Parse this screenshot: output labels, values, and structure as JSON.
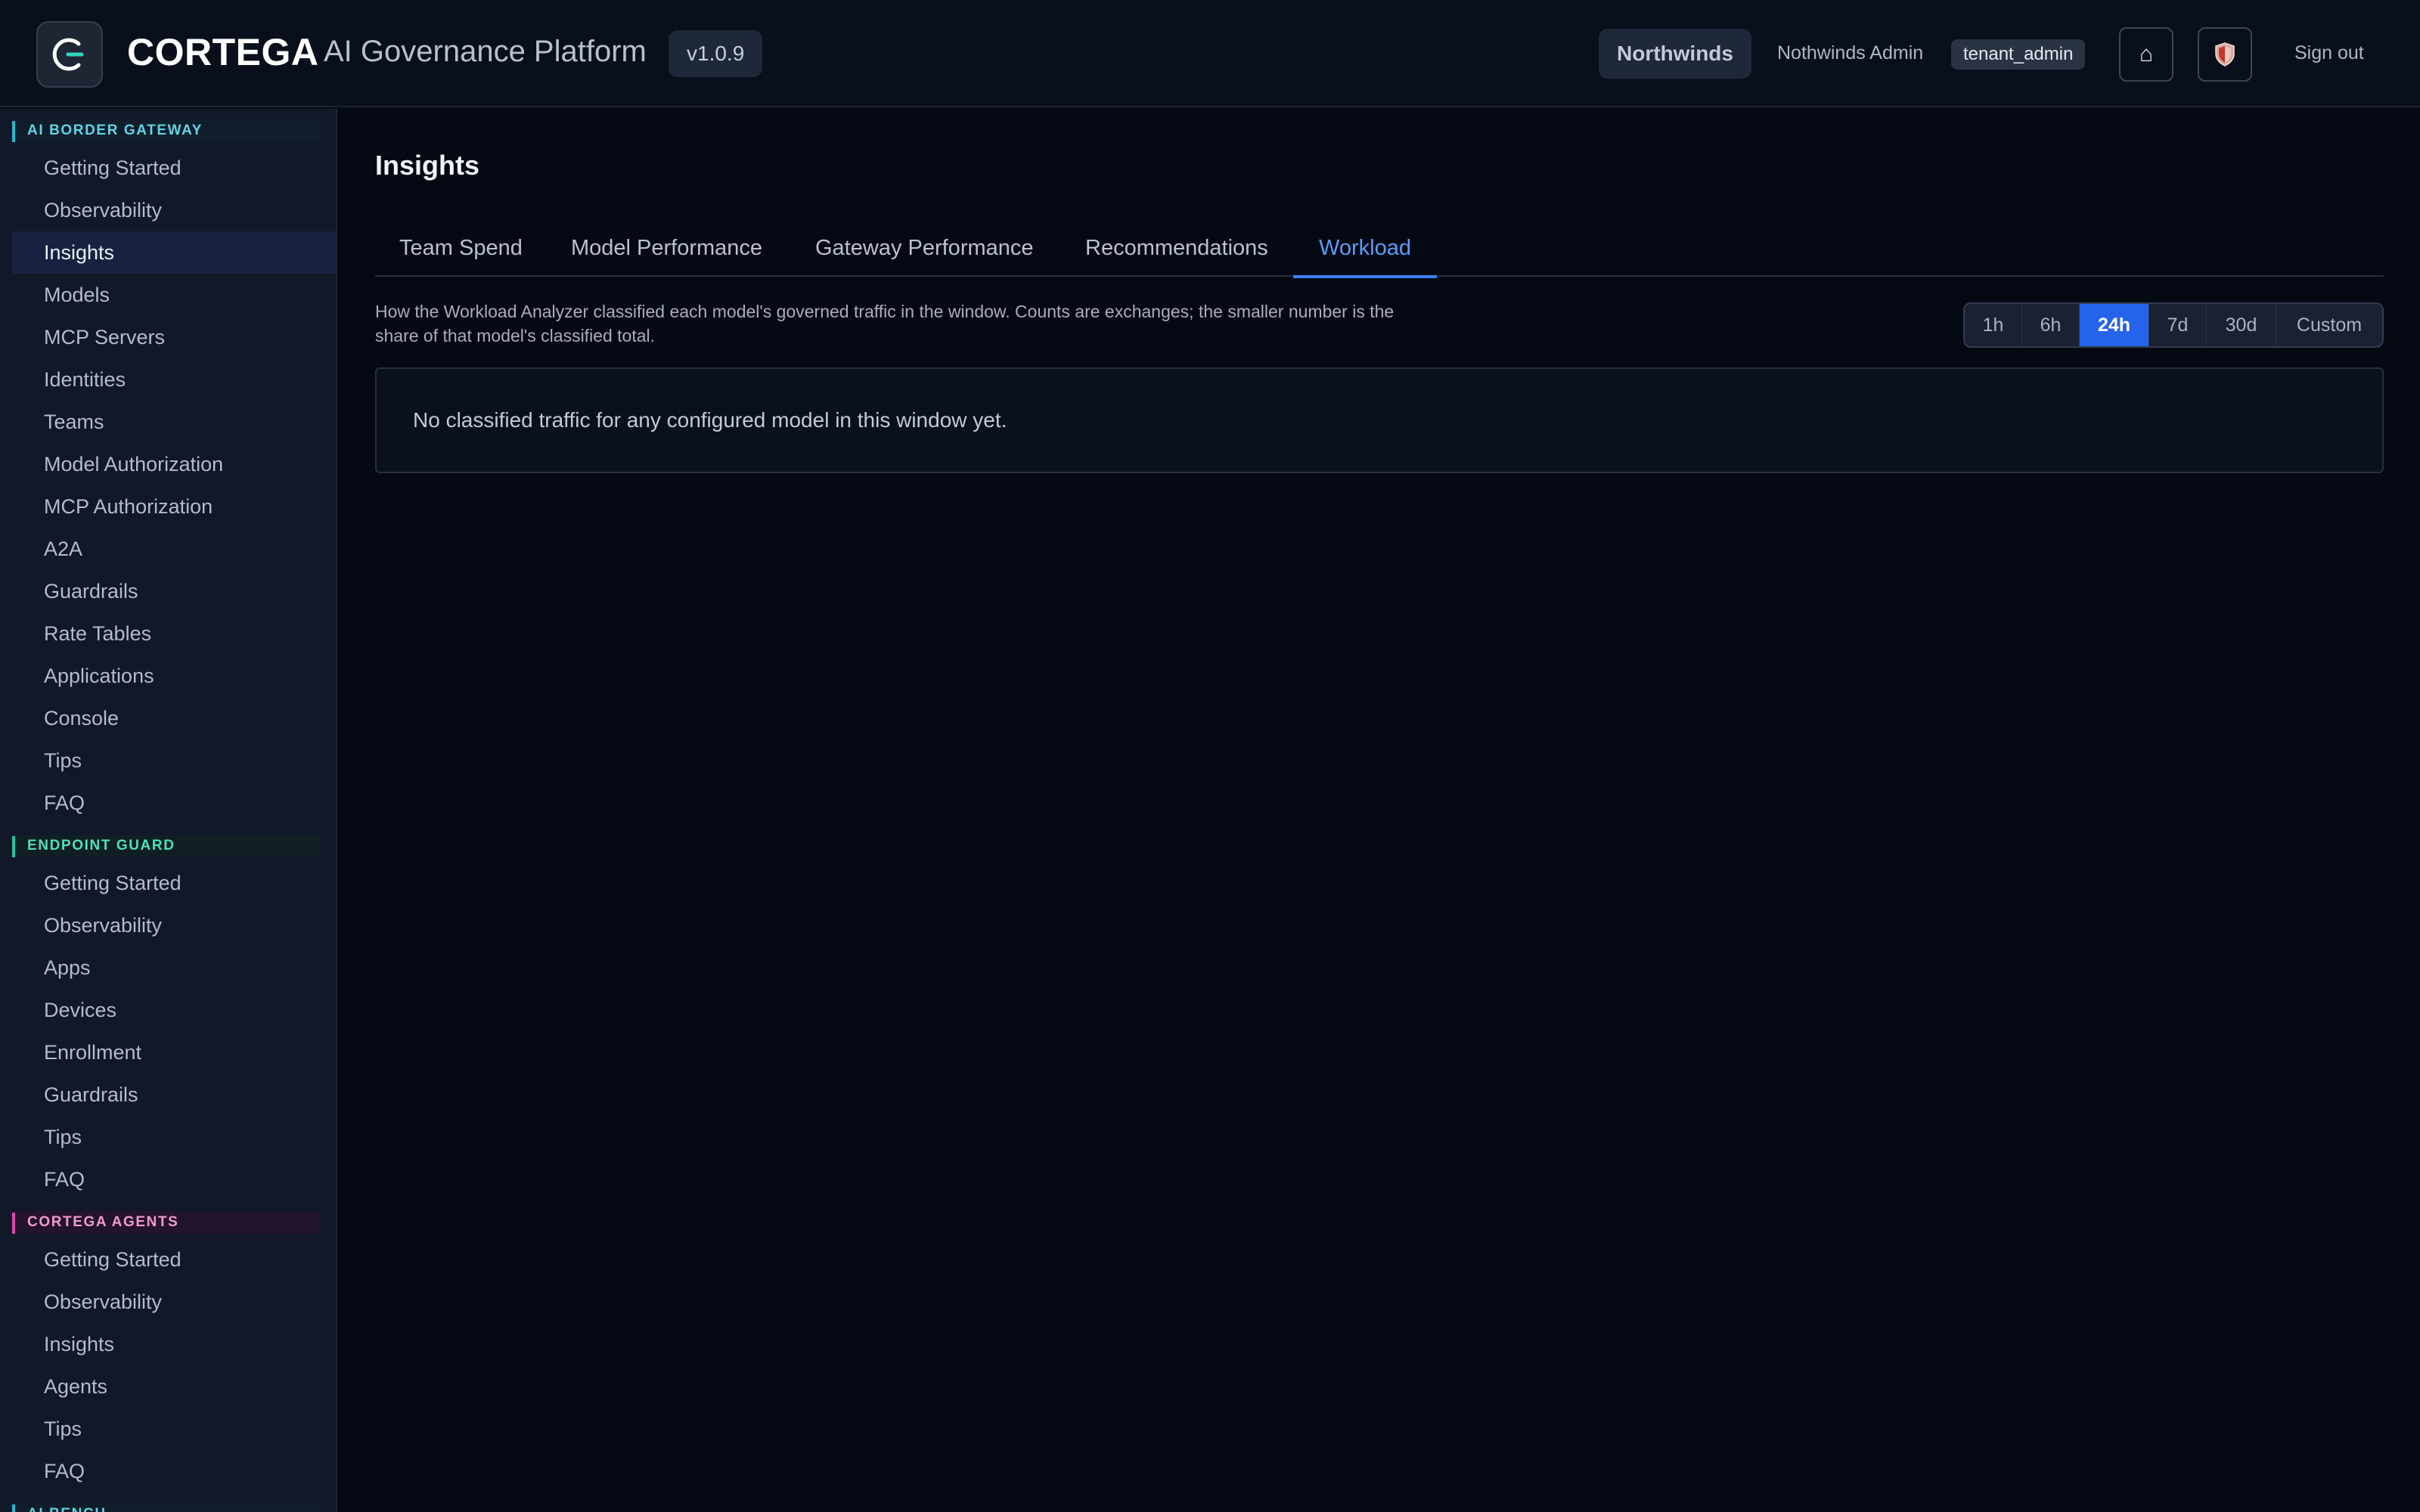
{
  "header": {
    "brand": "CORTEGA",
    "platform_name": "AI Governance Platform",
    "version": "v1.0.9",
    "tenant": "Northwinds",
    "user_name": "Nothwinds Admin",
    "role": "tenant_admin",
    "home_icon": "⌂",
    "shield_icon": "🛡",
    "sign_out": "Sign out"
  },
  "sidebar": {
    "sections": [
      {
        "title": "AI BORDER GATEWAY",
        "items": [
          "Getting Started",
          "Observability",
          "Insights",
          "Models",
          "MCP Servers",
          "Identities",
          "Teams",
          "Model Authorization",
          "MCP Authorization",
          "A2A",
          "Guardrails",
          "Rate Tables",
          "Applications",
          "Console",
          "Tips",
          "FAQ"
        ]
      },
      {
        "title": "ENDPOINT GUARD",
        "items": [
          "Getting Started",
          "Observability",
          "Apps",
          "Devices",
          "Enrollment",
          "Guardrails",
          "Tips",
          "FAQ"
        ]
      },
      {
        "title": "CORTEGA AGENTS",
        "items": [
          "Getting Started",
          "Observability",
          "Insights",
          "Agents",
          "Tips",
          "FAQ"
        ]
      },
      {
        "title": "AI BENCH",
        "items": []
      }
    ],
    "active_item": "Insights"
  },
  "main": {
    "title": "Insights",
    "tabs": [
      "Team Spend",
      "Model Performance",
      "Gateway Performance",
      "Recommendations",
      "Workload"
    ],
    "active_tab": "Workload",
    "description": "How the Workload Analyzer classified each model's governed traffic in the window. Counts are exchanges; the smaller number is the share of that model's classified total.",
    "time_ranges": [
      "1h",
      "6h",
      "24h",
      "7d",
      "30d",
      "Custom"
    ],
    "active_range": "24h",
    "empty_message": "No classified traffic for any configured model in this window yet."
  },
  "colors": {
    "accent": "#3b82f6",
    "background": "#050913",
    "sidebar": "#111827",
    "gateway_section": "#22b8cf",
    "endpoint_section": "#1fc59a",
    "agents_section": "#d946ae"
  }
}
